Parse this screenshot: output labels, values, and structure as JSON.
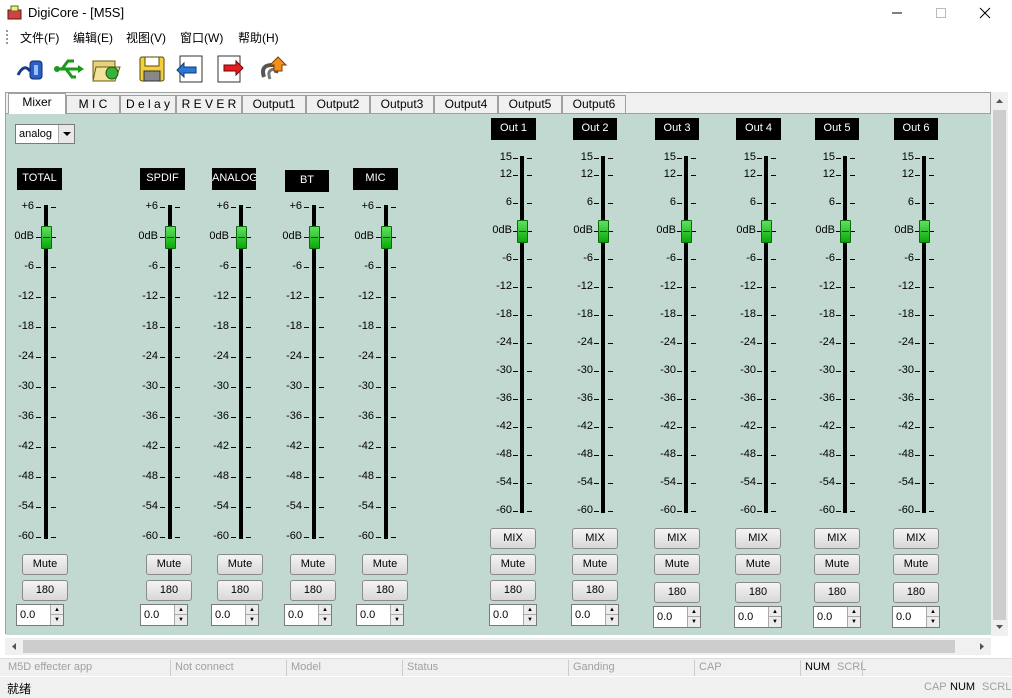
{
  "window": {
    "title": "DigiCore - [M5S]",
    "controls": [
      "minimize-icon",
      "maximize-icon",
      "close-icon"
    ]
  },
  "menu": {
    "items": [
      "文件(F)",
      "编辑(E)",
      "视图(V)",
      "窗口(W)",
      "帮助(H)"
    ]
  },
  "toolbar": {
    "icons": [
      "connect-icon",
      "usb-icon",
      "open-file-icon",
      "save-icon",
      "upload-icon",
      "download-icon",
      "update-icon"
    ]
  },
  "tabs": [
    {
      "label": "Mixer",
      "active": true
    },
    {
      "label": "M I C"
    },
    {
      "label": "D e l a y"
    },
    {
      "label": "R E V E R B"
    },
    {
      "label": "Output1"
    },
    {
      "label": "Output2"
    },
    {
      "label": "Output3"
    },
    {
      "label": "Output4"
    },
    {
      "label": "Output5"
    },
    {
      "label": "Output6"
    }
  ],
  "mixer": {
    "source_select": "analog",
    "input_scale": [
      "+6",
      "0dB",
      "-6",
      "-12",
      "-18",
      "-24",
      "-30",
      "-36",
      "-42",
      "-48",
      "-54",
      "-60"
    ],
    "output_scale": [
      "15",
      "12",
      "6",
      "0dB",
      "-6",
      "-12",
      "-18",
      "-24",
      "-30",
      "-36",
      "-42",
      "-48",
      "-54",
      "-60"
    ],
    "mute_label": "Mute",
    "phase_label": "180",
    "mix_label": "MIX",
    "input_channels": [
      {
        "name": "TOTAL",
        "level_db": 0,
        "value": "0.0"
      },
      {
        "name": "SPDIF",
        "level_db": 0,
        "value": "0.0"
      },
      {
        "name": "ANALOG",
        "level_db": 0,
        "value": "0.0"
      },
      {
        "name": "BT",
        "level_db": 0,
        "value": "0.0"
      },
      {
        "name": "MIC",
        "level_db": 0,
        "value": "0.0"
      }
    ],
    "output_channels": [
      {
        "name": "Out 1",
        "level_db": 0,
        "value": "0.0"
      },
      {
        "name": "Out 2",
        "level_db": 0,
        "value": "0.0"
      },
      {
        "name": "Out 3",
        "level_db": 0,
        "value": "0.0"
      },
      {
        "name": "Out 4",
        "level_db": 0,
        "value": "0.0"
      },
      {
        "name": "Out 5",
        "level_db": 0,
        "value": "0.0"
      },
      {
        "name": "Out 6",
        "level_db": 0,
        "value": "0.0"
      }
    ]
  },
  "statusbar": {
    "fields": [
      "M5D effecter app",
      "Not connect",
      "Model",
      "Status",
      "Ganding",
      "CAP",
      "NUM",
      "SCRL"
    ],
    "ready": "就绪",
    "indicators": [
      "CAP",
      "NUM",
      "SCRL"
    ]
  }
}
